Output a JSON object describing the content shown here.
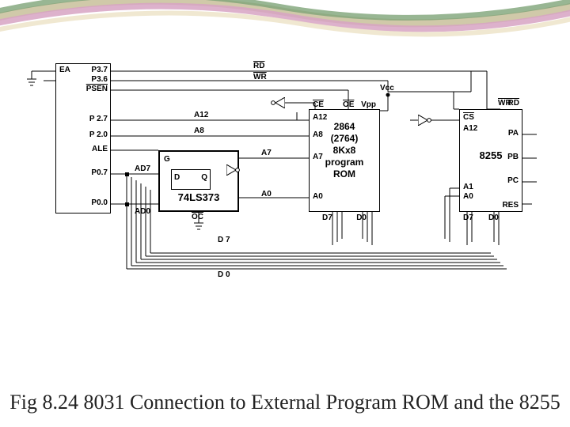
{
  "caption": "Fig  8.24 8031 Connection to External Program ROM and the 8255",
  "chips": {
    "mcu": {
      "pins": {
        "ea": "EA",
        "p37": "P3.7",
        "p36": "P3.6",
        "psen_bar": "PSEN",
        "p27": "P 2.7",
        "p20": "P 2.0",
        "ale": "ALE",
        "p07": "P0.7",
        "p00": "P0.0"
      },
      "bus_top": "AD7",
      "bus_bot": "AD0"
    },
    "latch": {
      "name": "74LS373",
      "d": "D",
      "q": "Q",
      "g": "G",
      "oc_bar": "OC"
    },
    "rom": {
      "line1": "2864",
      "line2": "(2764)",
      "line3": "8Kx8",
      "line4": "program",
      "line5": "ROM",
      "ce_bar": "CE",
      "a12": "A12",
      "a8": "A8",
      "a7": "A7",
      "a0": "A0",
      "oe_bar": "OE",
      "vpp": "Vpp",
      "d7": "D7",
      "d0": "D0"
    },
    "ppi": {
      "name": "8255",
      "cs_bar": "CS",
      "a12": "A12",
      "wr_bar": "WR",
      "rd_bar": "RD",
      "pa": "PA",
      "pb": "PB",
      "pc": "PC",
      "a1": "A1",
      "a0": "A0",
      "d7": "D7",
      "d0": "D0",
      "res": "RES"
    },
    "signals": {
      "rd_bar": "RD",
      "wr_bar": "WR",
      "vcc": "Vcc",
      "a12": "A12",
      "a8": "A8",
      "a7": "A7",
      "a0": "A0",
      "d7_bus": "D 7",
      "d0_bus": "D 0"
    }
  }
}
